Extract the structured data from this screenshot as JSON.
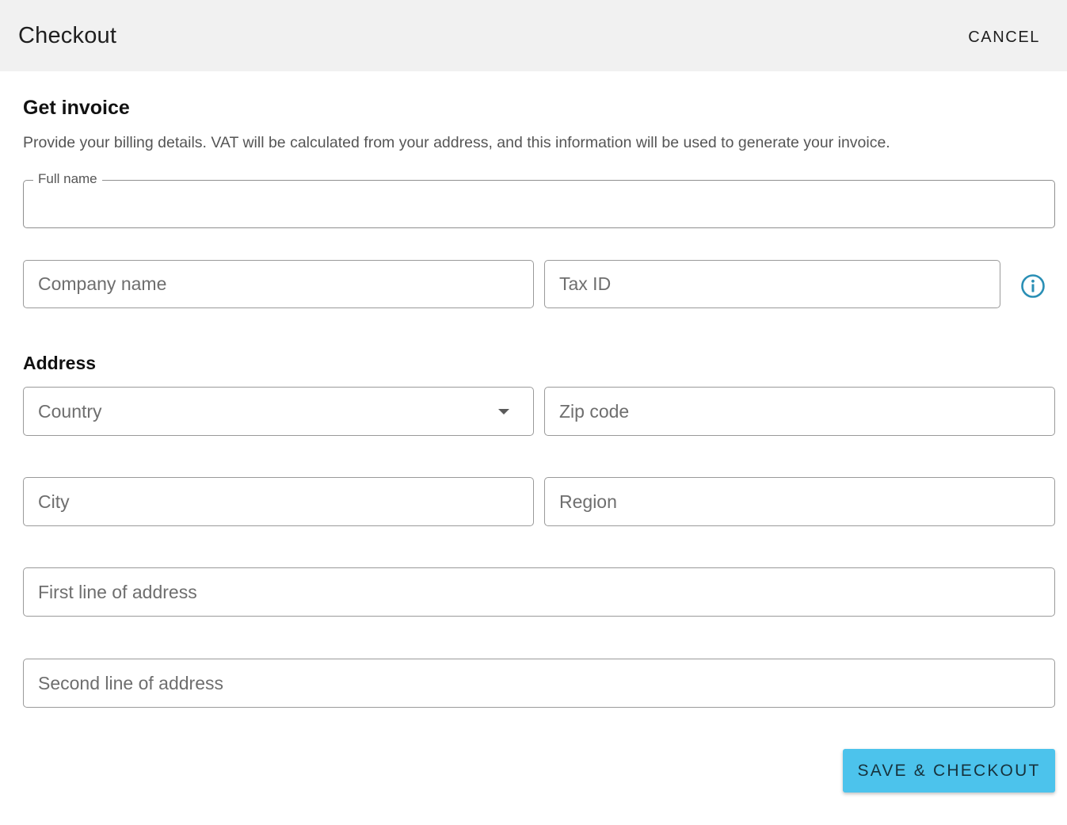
{
  "header": {
    "title": "Checkout",
    "cancel_label": "CANCEL"
  },
  "invoice": {
    "title": "Get invoice",
    "description": "Provide your billing details. VAT will be calculated from your address, and this information will be used to generate your invoice.",
    "full_name_label": "Full name",
    "full_name_value": "",
    "company_placeholder": "Company name",
    "tax_id_placeholder": "Tax ID",
    "info_icon": "info-icon"
  },
  "address": {
    "title": "Address",
    "country_placeholder": "Country",
    "zip_placeholder": "Zip code",
    "city_placeholder": "City",
    "region_placeholder": "Region",
    "line1_placeholder": "First line of address",
    "line2_placeholder": "Second line of address"
  },
  "actions": {
    "save_label": "SAVE & CHECKOUT"
  },
  "colors": {
    "header_bg": "#f1f1f1",
    "primary_button": "#4cc3ec",
    "info_icon": "#2a8fb5",
    "border": "#9a9a9a"
  }
}
